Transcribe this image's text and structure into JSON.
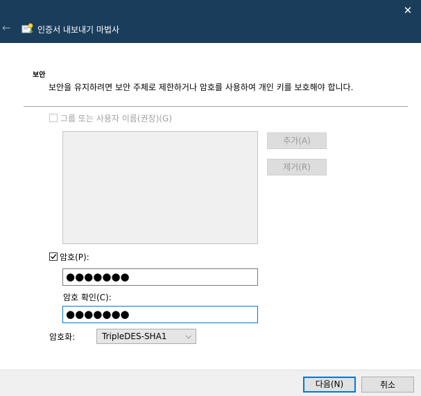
{
  "window": {
    "title": "인증서 내보내기 마법사",
    "close_glyph": "✕",
    "back_glyph": "←",
    "accent_color": "#1a3d5c",
    "focus_color": "#0078d7"
  },
  "section": {
    "heading": "보안",
    "description": "보안을 유지하려면 보안 주체로 제한하거나 암호를 사용하여 개인 키를 보호해야 합니다."
  },
  "group_or_user": {
    "label": "그룹 또는 사용자 이름(권장)(G)",
    "checked": false,
    "enabled": false,
    "add_button": "추가(A)",
    "remove_button": "제거(R)"
  },
  "password": {
    "label": "암호(P):",
    "checked": true,
    "value": "●●●●●●●",
    "confirm_label": "암호 확인(C):",
    "confirm_value": "●●●●●●●"
  },
  "encryption": {
    "label": "암호화:",
    "selected": "TripleDES-SHA1"
  },
  "footer": {
    "next_button": "다음(N)",
    "cancel_button": "취소"
  }
}
